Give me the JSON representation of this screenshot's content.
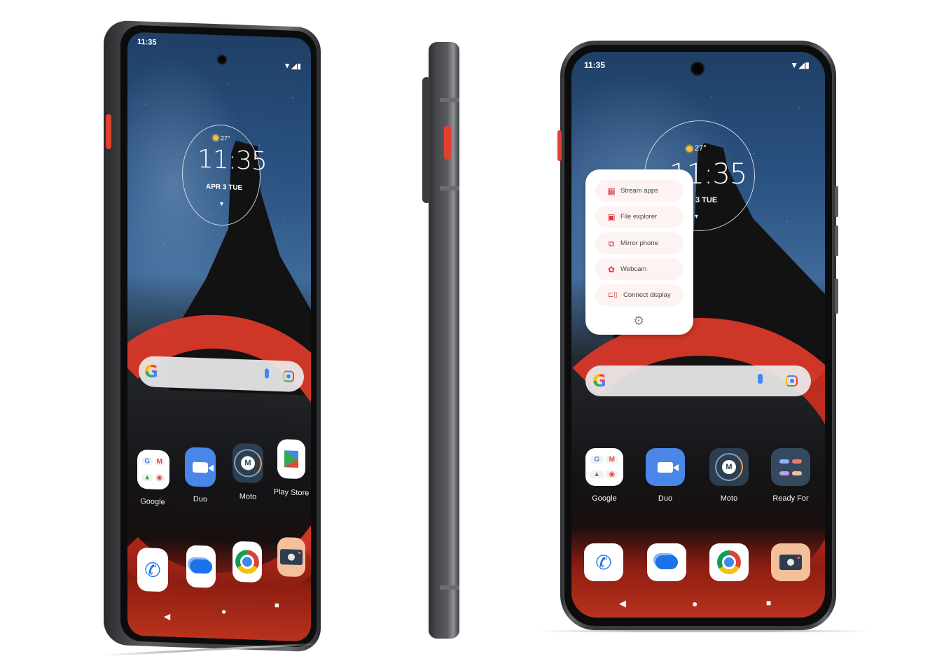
{
  "status_bar": {
    "time": "11:35",
    "signal_icons": "▼◢▮"
  },
  "clock_widget": {
    "weather_temp": "27°",
    "time": "11:35",
    "date_left": "APR 3 TUE",
    "date_right": "3 TUE",
    "expand_glyph": "▾"
  },
  "search_bar": {
    "logo": "G",
    "mic_glyph": "🎙"
  },
  "left_phone": {
    "apps": [
      {
        "label": "Google",
        "type": "folder"
      },
      {
        "label": "Duo",
        "type": "duo"
      },
      {
        "label": "Moto",
        "type": "moto"
      },
      {
        "label": "Play Store",
        "type": "play"
      }
    ]
  },
  "right_phone": {
    "apps": [
      {
        "label": "Google",
        "type": "folder"
      },
      {
        "label": "Duo",
        "type": "duo"
      },
      {
        "label": "Moto",
        "type": "moto"
      },
      {
        "label": "Ready For",
        "type": "ready"
      }
    ],
    "ready_for_menu": {
      "items": [
        {
          "label": "Stream apps",
          "icon": "▦"
        },
        {
          "label": "File explorer",
          "icon": "▣"
        },
        {
          "label": "Mirror phone",
          "icon": "⧉"
        },
        {
          "label": "Webcam",
          "icon": "✿"
        },
        {
          "label": "Connect display",
          "icon": "⊏▯"
        }
      ],
      "settings_icon": "⚙"
    }
  },
  "folder_letters": [
    "G",
    "M",
    "▲",
    "◉"
  ],
  "dock": [
    {
      "name": "phone",
      "glyph": "✆"
    },
    {
      "name": "messages"
    },
    {
      "name": "chrome"
    },
    {
      "name": "camera"
    }
  ],
  "nav": {
    "back": "◀",
    "home": "●",
    "recents": "■"
  },
  "colors": {
    "accent_red": "#d93743",
    "side_key": "#e0402f",
    "duo_blue": "#4a86e8"
  }
}
